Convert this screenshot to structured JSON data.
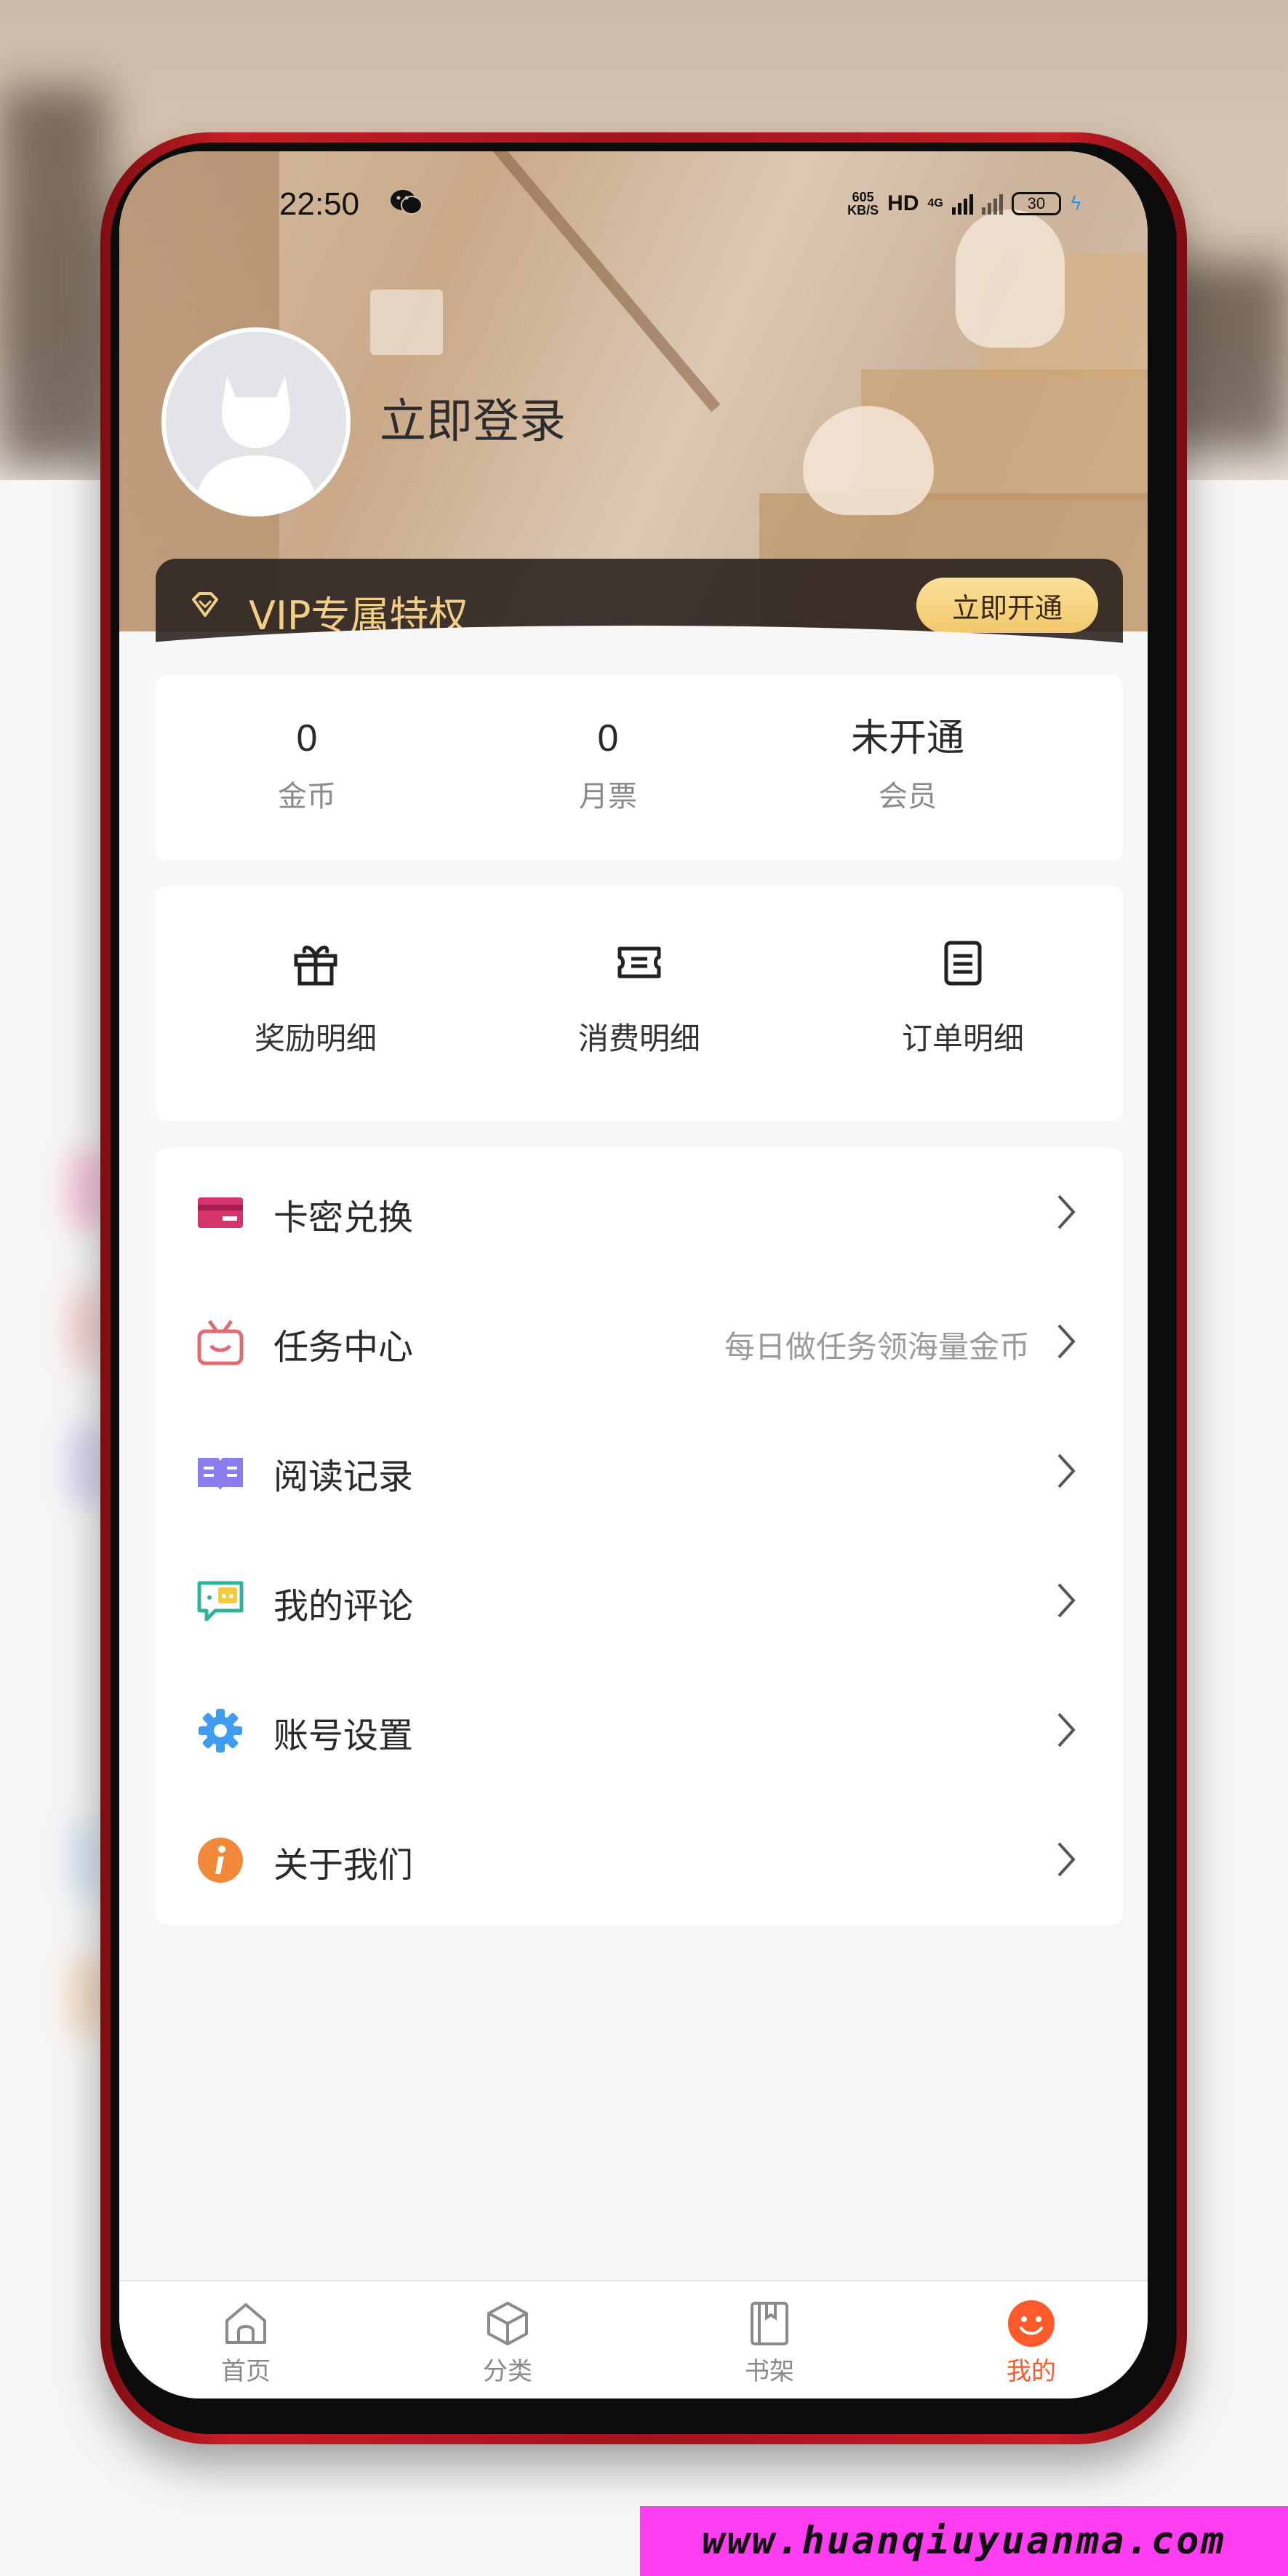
{
  "status_bar": {
    "time": "22:50",
    "net_speed_value": "605",
    "net_speed_unit": "KB/S",
    "hd": "HD",
    "network": "4G",
    "battery": "30"
  },
  "profile": {
    "login_label": "立即登录"
  },
  "vip": {
    "title": "VIP专属特权",
    "button": "立即开通"
  },
  "stats": [
    {
      "value": "0",
      "label": "金币"
    },
    {
      "value": "0",
      "label": "月票"
    },
    {
      "value": "未开通",
      "label": "会员"
    }
  ],
  "actions": [
    {
      "label": "奖励明细",
      "icon": "gift-icon"
    },
    {
      "label": "消费明细",
      "icon": "ticket-icon"
    },
    {
      "label": "订单明细",
      "icon": "order-list-icon"
    }
  ],
  "menu": [
    {
      "label": "卡密兑换",
      "hint": "",
      "icon": "card-icon",
      "color": "#d6336c"
    },
    {
      "label": "任务中心",
      "hint": "每日做任务领海量金币",
      "icon": "task-gift-icon",
      "color": "#e06c73"
    },
    {
      "label": "阅读记录",
      "hint": "",
      "icon": "book-open-icon",
      "color": "#8b7cf0"
    },
    {
      "label": "我的评论",
      "hint": "",
      "icon": "comment-icon",
      "color": "#2fb39b"
    },
    {
      "label": "账号设置",
      "hint": "",
      "icon": "gear-icon",
      "color": "#3e9cf2"
    },
    {
      "label": "关于我们",
      "hint": "",
      "icon": "info-icon",
      "color": "#f08a3a"
    }
  ],
  "bottom_nav": [
    {
      "label": "首页",
      "icon": "home-icon",
      "active": false
    },
    {
      "label": "分类",
      "icon": "category-cube-icon",
      "active": false
    },
    {
      "label": "书架",
      "icon": "bookshelf-icon",
      "active": false
    },
    {
      "label": "我的",
      "icon": "smile-profile-icon",
      "active": true
    }
  ],
  "colors": {
    "accent": "#ff5a2c",
    "vip_gold": "#f1cf87",
    "frame_red": "#c51d26"
  },
  "watermark": "www.huanqiuyuanma.com"
}
